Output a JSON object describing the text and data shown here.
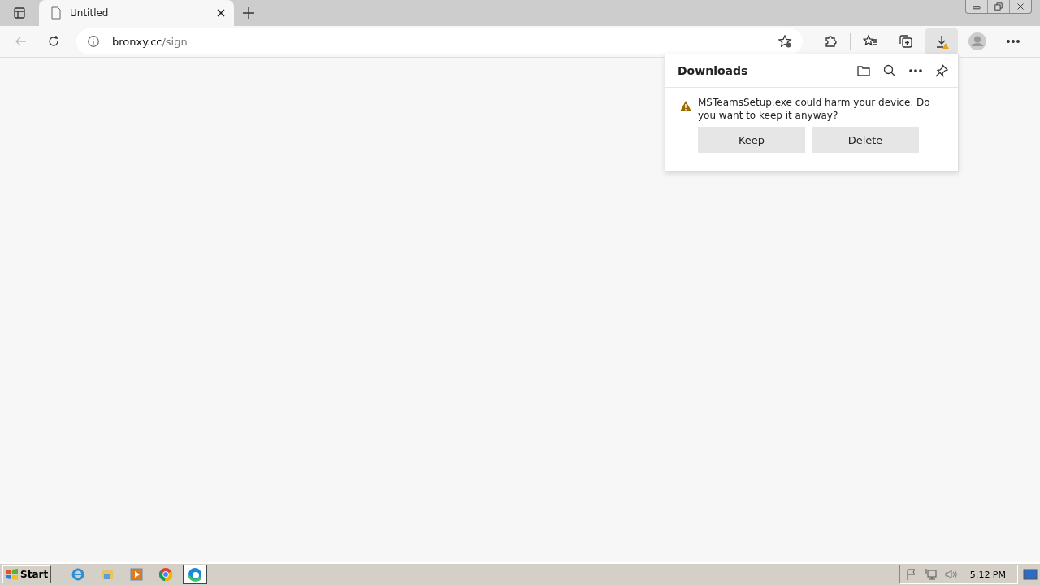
{
  "tabs": [
    {
      "title": "Untitled",
      "selected": true
    }
  ],
  "address_bar": {
    "host": "bronxy.cc",
    "path": "/sign"
  },
  "downloads_panel": {
    "title": "Downloads",
    "message": "MSTeamsSetup.exe could harm your device. Do you want to keep it anyway?",
    "buttons": [
      "Keep",
      "Delete"
    ]
  },
  "taskbar": {
    "start": "Start",
    "apps": [
      {
        "kind": "ie",
        "selected": false
      },
      {
        "kind": "explorer",
        "selected": false
      },
      {
        "kind": "media",
        "selected": false
      },
      {
        "kind": "chrome",
        "selected": false
      },
      {
        "kind": "edge",
        "selected": true
      }
    ],
    "clock": "5:12 PM"
  }
}
